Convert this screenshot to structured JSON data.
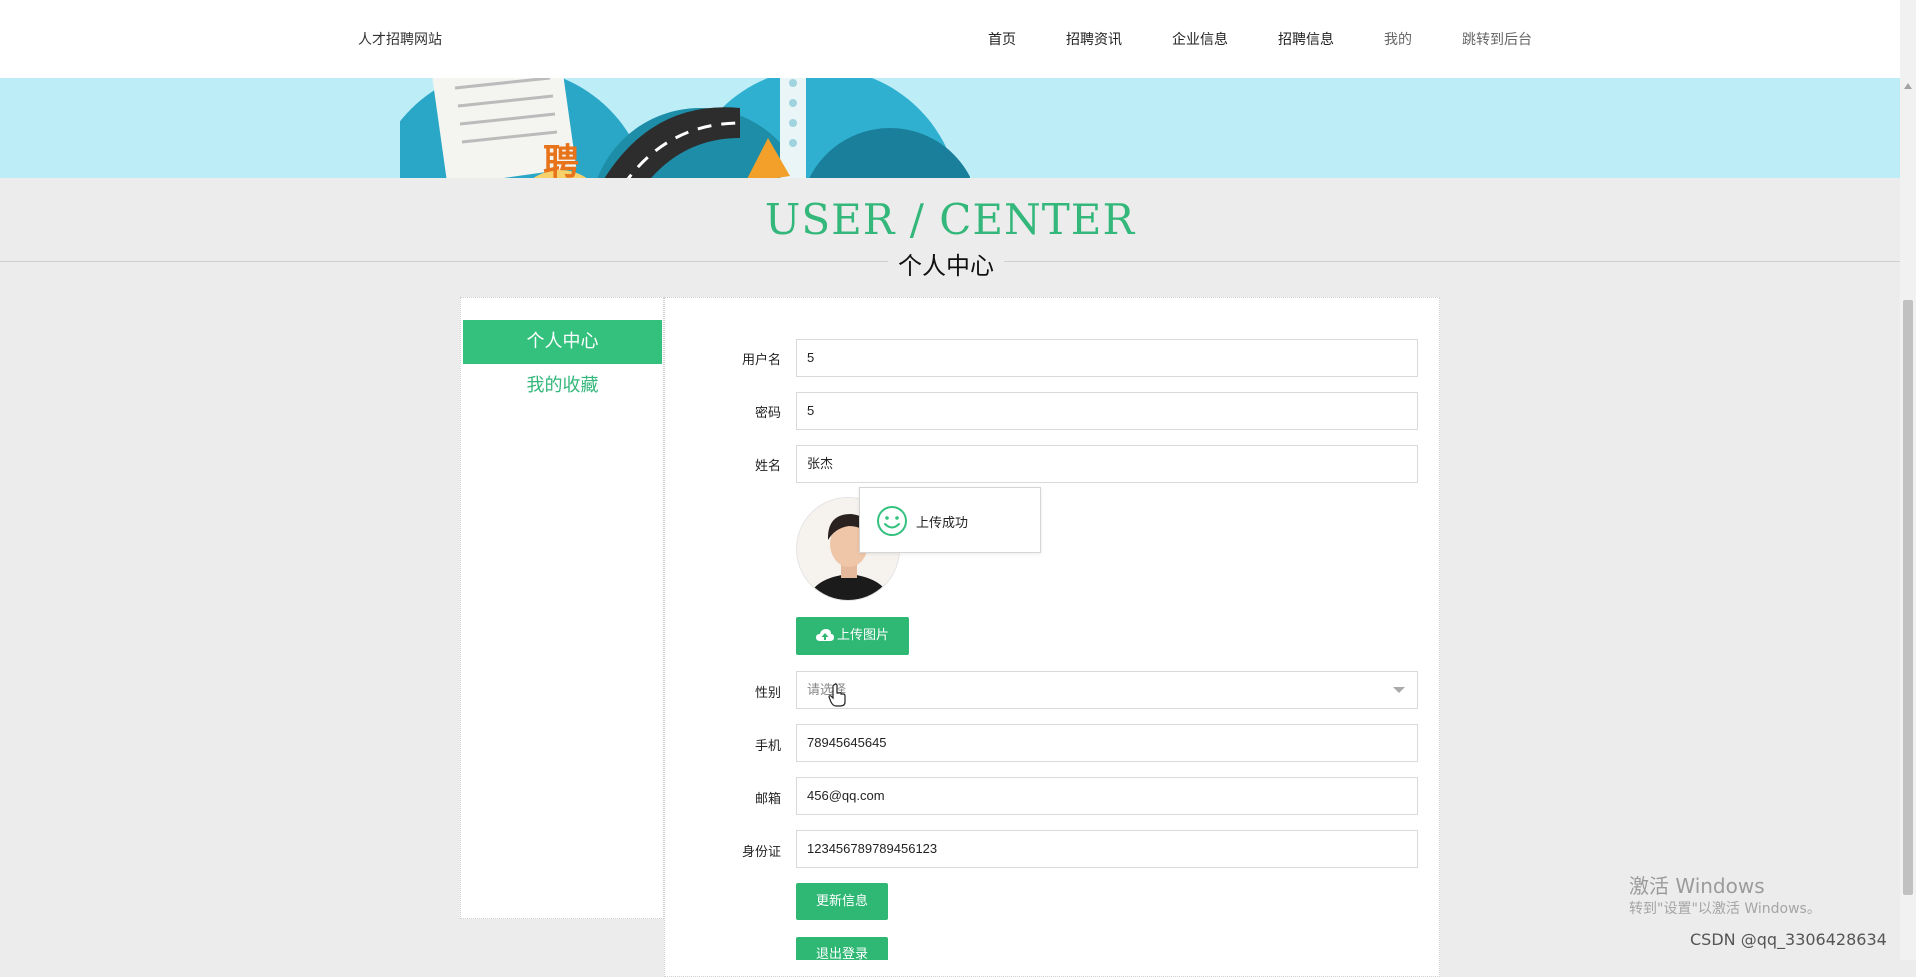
{
  "header": {
    "site_title": "人才招聘网站",
    "nav": [
      "首页",
      "招聘资讯",
      "企业信息",
      "招聘信息",
      "我的",
      "跳转到后台"
    ]
  },
  "banner": {
    "stamp_text": "聘"
  },
  "section": {
    "title_en": "USER / CENTER",
    "title_cn": "个人中心"
  },
  "sidebar": {
    "items": [
      "个人中心",
      "我的收藏"
    ]
  },
  "form": {
    "username": {
      "label": "用户名",
      "value": "5"
    },
    "password": {
      "label": "密码",
      "value": "5"
    },
    "name": {
      "label": "姓名",
      "value": "张杰"
    },
    "gender": {
      "label": "性别",
      "placeholder": "请选择"
    },
    "phone": {
      "label": "手机",
      "value": "78945645645"
    },
    "email": {
      "label": "邮箱",
      "value": "456@qq.com"
    },
    "idcard": {
      "label": "身份证",
      "value": "123456789789456123"
    },
    "upload_button": "上传图片",
    "update_button": "更新信息",
    "logout_button": "退出登录"
  },
  "toast": {
    "message": "上传成功"
  },
  "watermark": {
    "windows_title": "激活 Windows",
    "windows_sub": "转到\"设置\"以激活 Windows。",
    "csdn": "CSDN @qq_3306428634"
  },
  "colors": {
    "accent": "#34c17e",
    "banner": "#bdeef8",
    "background": "#ececec"
  }
}
